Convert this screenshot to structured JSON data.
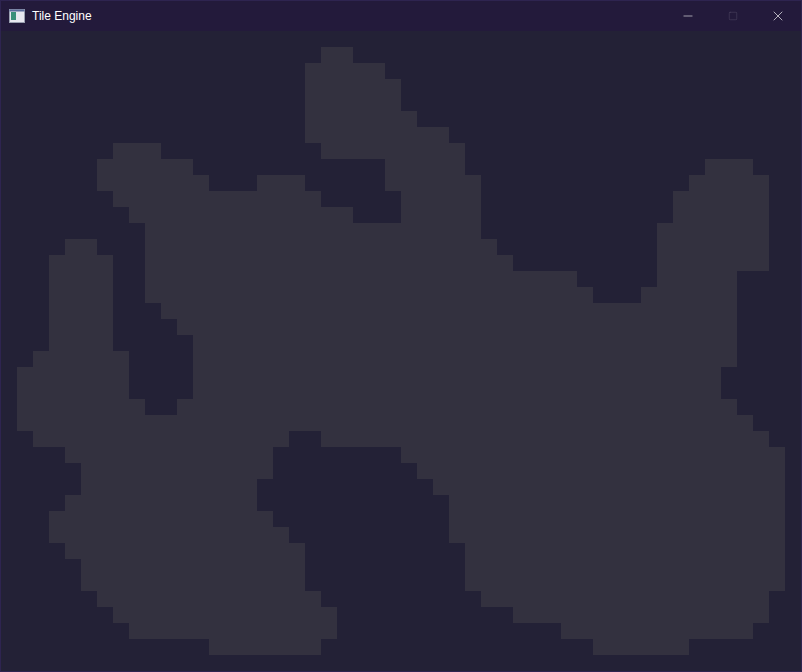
{
  "window": {
    "title": "Tile Engine",
    "maximize_disabled": true
  },
  "map": {
    "columns": 50,
    "rows": [
      [],
      [
        [
          20,
          21
        ]
      ],
      [
        [
          19,
          23
        ]
      ],
      [
        [
          19,
          24
        ]
      ],
      [
        [
          19,
          24
        ]
      ],
      [
        [
          19,
          25
        ]
      ],
      [
        [
          19,
          27
        ]
      ],
      [
        [
          7,
          9
        ],
        [
          20,
          28
        ]
      ],
      [
        [
          6,
          11
        ],
        [
          24,
          28
        ],
        [
          44,
          46
        ]
      ],
      [
        [
          6,
          12
        ],
        [
          16,
          18
        ],
        [
          24,
          29
        ],
        [
          43,
          47
        ]
      ],
      [
        [
          7,
          19
        ],
        [
          25,
          29
        ],
        [
          42,
          47
        ]
      ],
      [
        [
          8,
          21
        ],
        [
          25,
          29
        ],
        [
          42,
          47
        ]
      ],
      [
        [
          9,
          29
        ],
        [
          41,
          47
        ]
      ],
      [
        [
          4,
          5
        ],
        [
          9,
          30
        ],
        [
          41,
          47
        ]
      ],
      [
        [
          3,
          6
        ],
        [
          9,
          31
        ],
        [
          41,
          47
        ]
      ],
      [
        [
          3,
          6
        ],
        [
          9,
          35
        ],
        [
          41,
          45
        ]
      ],
      [
        [
          3,
          6
        ],
        [
          9,
          36
        ],
        [
          40,
          45
        ]
      ],
      [
        [
          3,
          6
        ],
        [
          10,
          45
        ]
      ],
      [
        [
          3,
          6
        ],
        [
          11,
          45
        ]
      ],
      [
        [
          3,
          6
        ],
        [
          12,
          45
        ]
      ],
      [
        [
          2,
          7
        ],
        [
          12,
          45
        ]
      ],
      [
        [
          1,
          7
        ],
        [
          12,
          44
        ]
      ],
      [
        [
          1,
          7
        ],
        [
          12,
          44
        ]
      ],
      [
        [
          1,
          8
        ],
        [
          11,
          45
        ]
      ],
      [
        [
          1,
          46
        ]
      ],
      [
        [
          2,
          17
        ],
        [
          20,
          47
        ]
      ],
      [
        [
          4,
          16
        ],
        [
          25,
          48
        ]
      ],
      [
        [
          5,
          16
        ],
        [
          26,
          48
        ]
      ],
      [
        [
          5,
          15
        ],
        [
          27,
          48
        ]
      ],
      [
        [
          4,
          15
        ],
        [
          28,
          48
        ]
      ],
      [
        [
          3,
          16
        ],
        [
          28,
          48
        ]
      ],
      [
        [
          3,
          17
        ],
        [
          28,
          48
        ]
      ],
      [
        [
          4,
          18
        ],
        [
          29,
          48
        ]
      ],
      [
        [
          5,
          18
        ],
        [
          29,
          48
        ]
      ],
      [
        [
          5,
          18
        ],
        [
          29,
          48
        ]
      ],
      [
        [
          6,
          19
        ],
        [
          30,
          47
        ]
      ],
      [
        [
          7,
          20
        ],
        [
          32,
          47
        ]
      ],
      [
        [
          8,
          20
        ],
        [
          35,
          46
        ]
      ],
      [
        [
          13,
          19
        ],
        [
          37,
          42
        ]
      ],
      []
    ]
  }
}
